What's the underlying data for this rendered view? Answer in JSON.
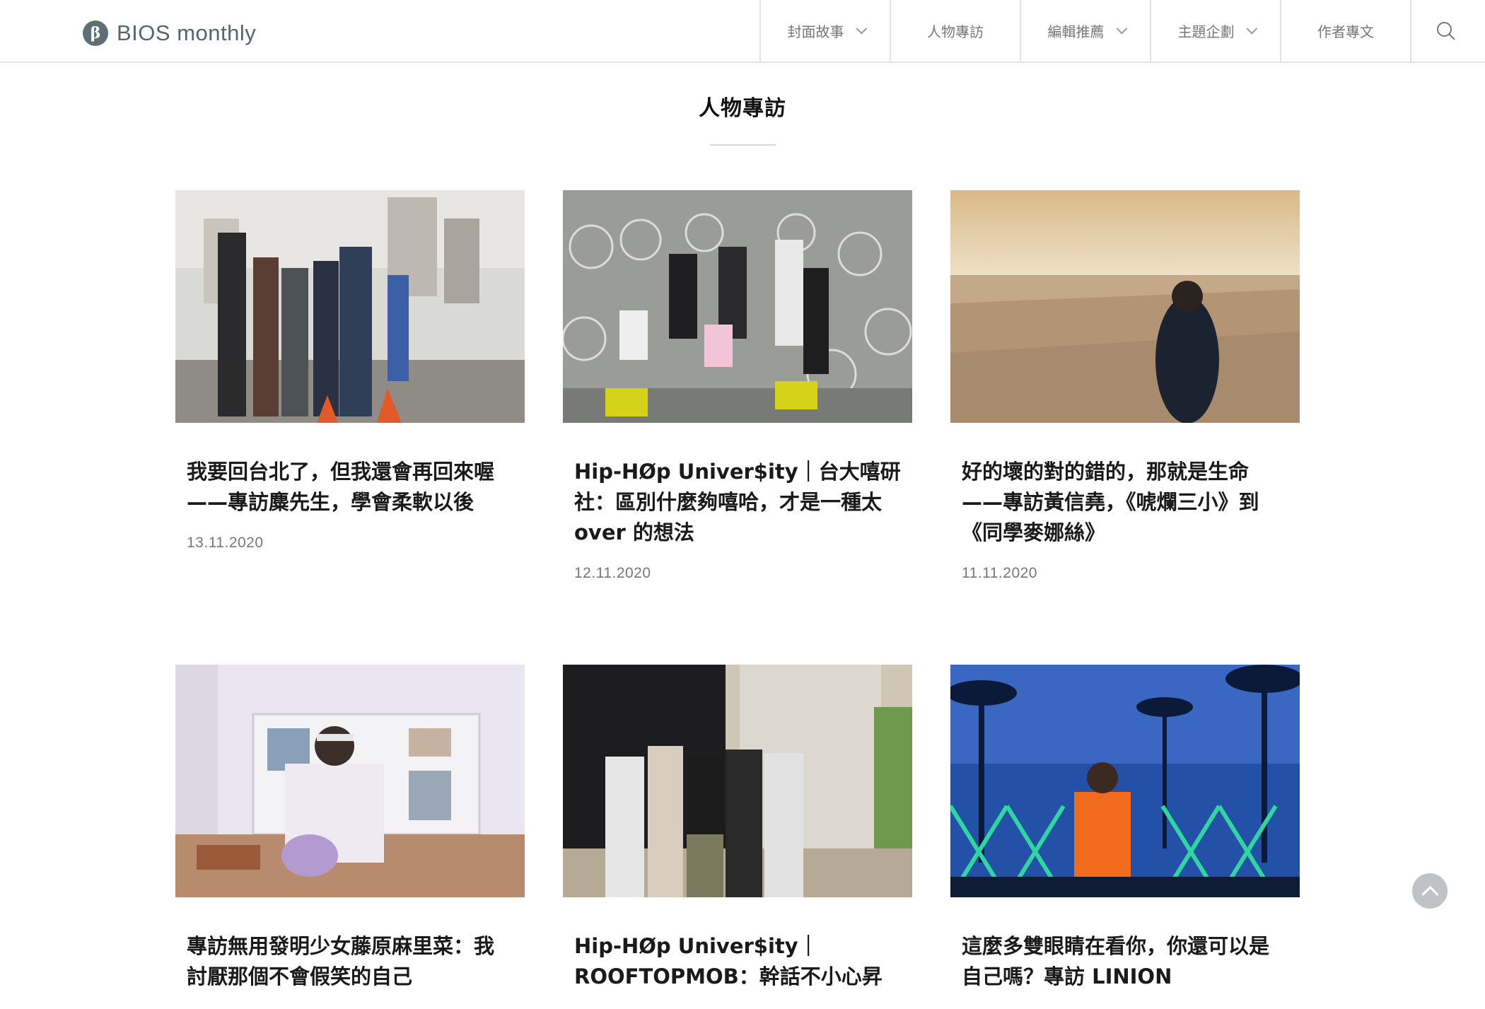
{
  "header": {
    "logo_text": "BIOS monthly",
    "logo_mark": "β",
    "nav": [
      {
        "label": "封面故事",
        "dropdown": true
      },
      {
        "label": "人物專訪",
        "dropdown": false
      },
      {
        "label": "編輯推薦",
        "dropdown": true
      },
      {
        "label": "主題企劃",
        "dropdown": true
      },
      {
        "label": "作者專文",
        "dropdown": false
      }
    ],
    "search_icon": "search-icon"
  },
  "section": {
    "title": "人物專訪"
  },
  "articles": [
    {
      "title": "我要回台北了，但我還會再回來喔——專訪麋先生，學會柔軟以後",
      "date": "13.11.2020"
    },
    {
      "title": "Hip-HØp Univer$ity｜台大嘻研社：區別什麼夠嘻哈，才是一種太 over 的想法",
      "date": "12.11.2020"
    },
    {
      "title": "好的壞的對的錯的，那就是生命——專訪黃信堯，《唬爛三小》到《同學麥娜絲》",
      "date": "11.11.2020"
    },
    {
      "title": "專訪無用發明少女藤原麻里菜：我討厭那個不會假笑的自己",
      "date": ""
    },
    {
      "title": "Hip-HØp Univer$ity｜ROOFTOPMOB：幹話不小心昇",
      "date": ""
    },
    {
      "title": "這麼多雙眼睛在看你，你還可以是自己嗎？專訪 LINION",
      "date": ""
    }
  ],
  "back_to_top_icon": "chevron-up-icon",
  "colors": {
    "logo": "#55666c",
    "divider": "#e3e3e3",
    "date": "#777777"
  }
}
